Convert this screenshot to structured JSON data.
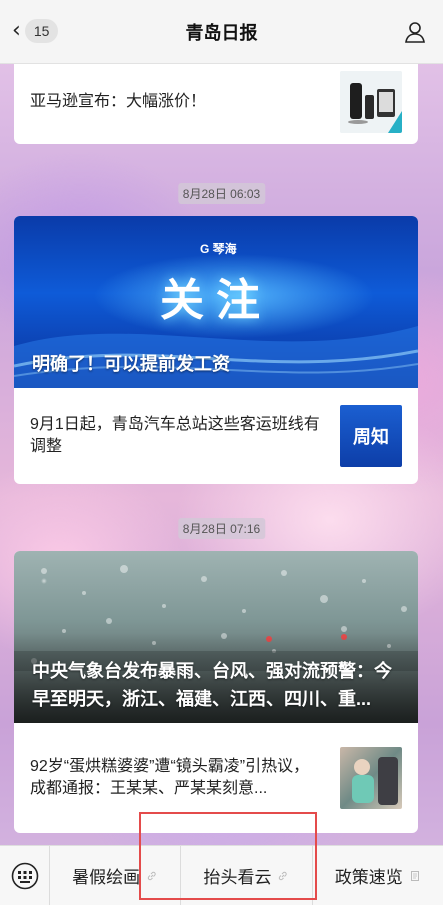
{
  "header": {
    "title": "青岛日报",
    "back_count": "15"
  },
  "articles": {
    "item1": {
      "title": "亚马逊宣布：大幅涨价！"
    },
    "time1": "8月28日 06:03",
    "group1": {
      "hero_banner_brand": "G 琴海",
      "hero_banner_text": "关注",
      "hero_title": "明确了！可以提前发工资",
      "item_title": "9月1日起，青岛汽车总站这些客运班线有调整",
      "item_thumb_text": "周知"
    },
    "time2": "8月28日 07:16",
    "group2": {
      "hero_title": "中央气象台发布暴雨、台风、强对流预警：今早至明天，浙江、福建、江西、四川、重...",
      "item_title": "92岁“蛋烘糕婆婆”遭“镜头霸凌”引热议，成都通报：王某某、严某某刻意..."
    }
  },
  "bottom_menu": {
    "items": [
      {
        "label": "暑假绘画",
        "icon": "link-icon"
      },
      {
        "label": "抬头看云",
        "icon": "link-icon"
      },
      {
        "label": "政策速览",
        "icon": "document-icon"
      }
    ]
  },
  "colors": {
    "highlight": "#e44b4b",
    "banner_blue": "#0e5bd8"
  }
}
